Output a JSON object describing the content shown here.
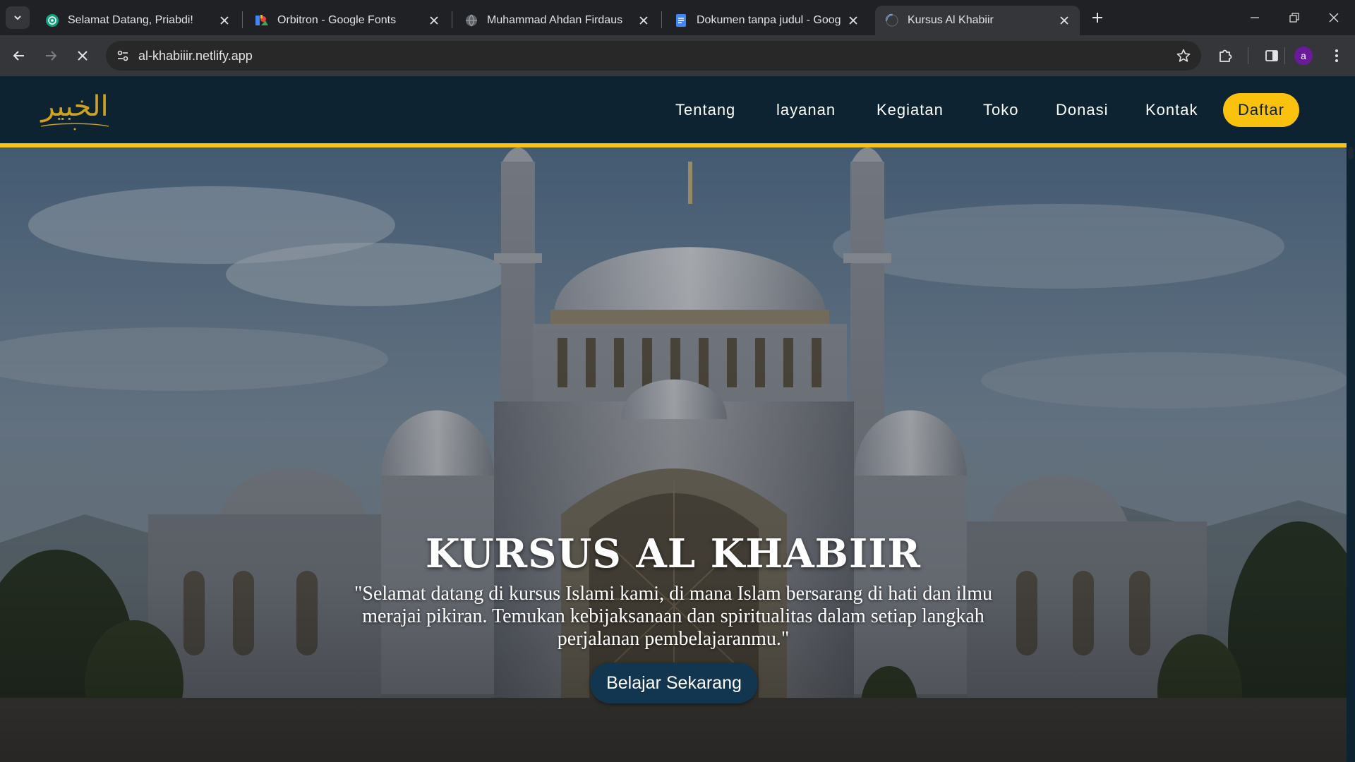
{
  "browser": {
    "tabs": [
      {
        "title": "Selamat Datang, Priabdi!",
        "icon": "chatgpt-icon",
        "active": false
      },
      {
        "title": "Orbitron - Google Fonts",
        "icon": "google-fonts-icon",
        "active": false
      },
      {
        "title": "Muhammad Ahdan Firdaus",
        "icon": "globe-icon",
        "active": false
      },
      {
        "title": "Dokumen tanpa judul - Google",
        "icon": "google-docs-icon",
        "active": false
      },
      {
        "title": "Kursus Al Khabiir",
        "icon": "loading-spinner-icon",
        "active": true
      }
    ],
    "url": "al-khabiiir.netlify.app",
    "profile_initial": "a",
    "loading": true
  },
  "site": {
    "logo_text": "الخبير",
    "nav": [
      "Tentang",
      "layanan",
      "Kegiatan",
      "Toko",
      "Donasi",
      "Kontak"
    ],
    "cta_nav": "Daftar",
    "hero": {
      "title": "KURSUS AL KHABIIR",
      "quote": "\"Selamat datang di kursus Islami kami, di mana Islam bersarang di hati dan ilmu merajai pikiran. Temukan kebijaksanaan dan spiritualitas dalam setiap langkah perjalanan pembelajaranmu.\"",
      "button": "Belajar Sekarang",
      "background": "mosque-image"
    }
  },
  "colors": {
    "header_bg": "#0d2331",
    "accent_gold": "#fbc20d",
    "cta_bg": "#123650"
  }
}
